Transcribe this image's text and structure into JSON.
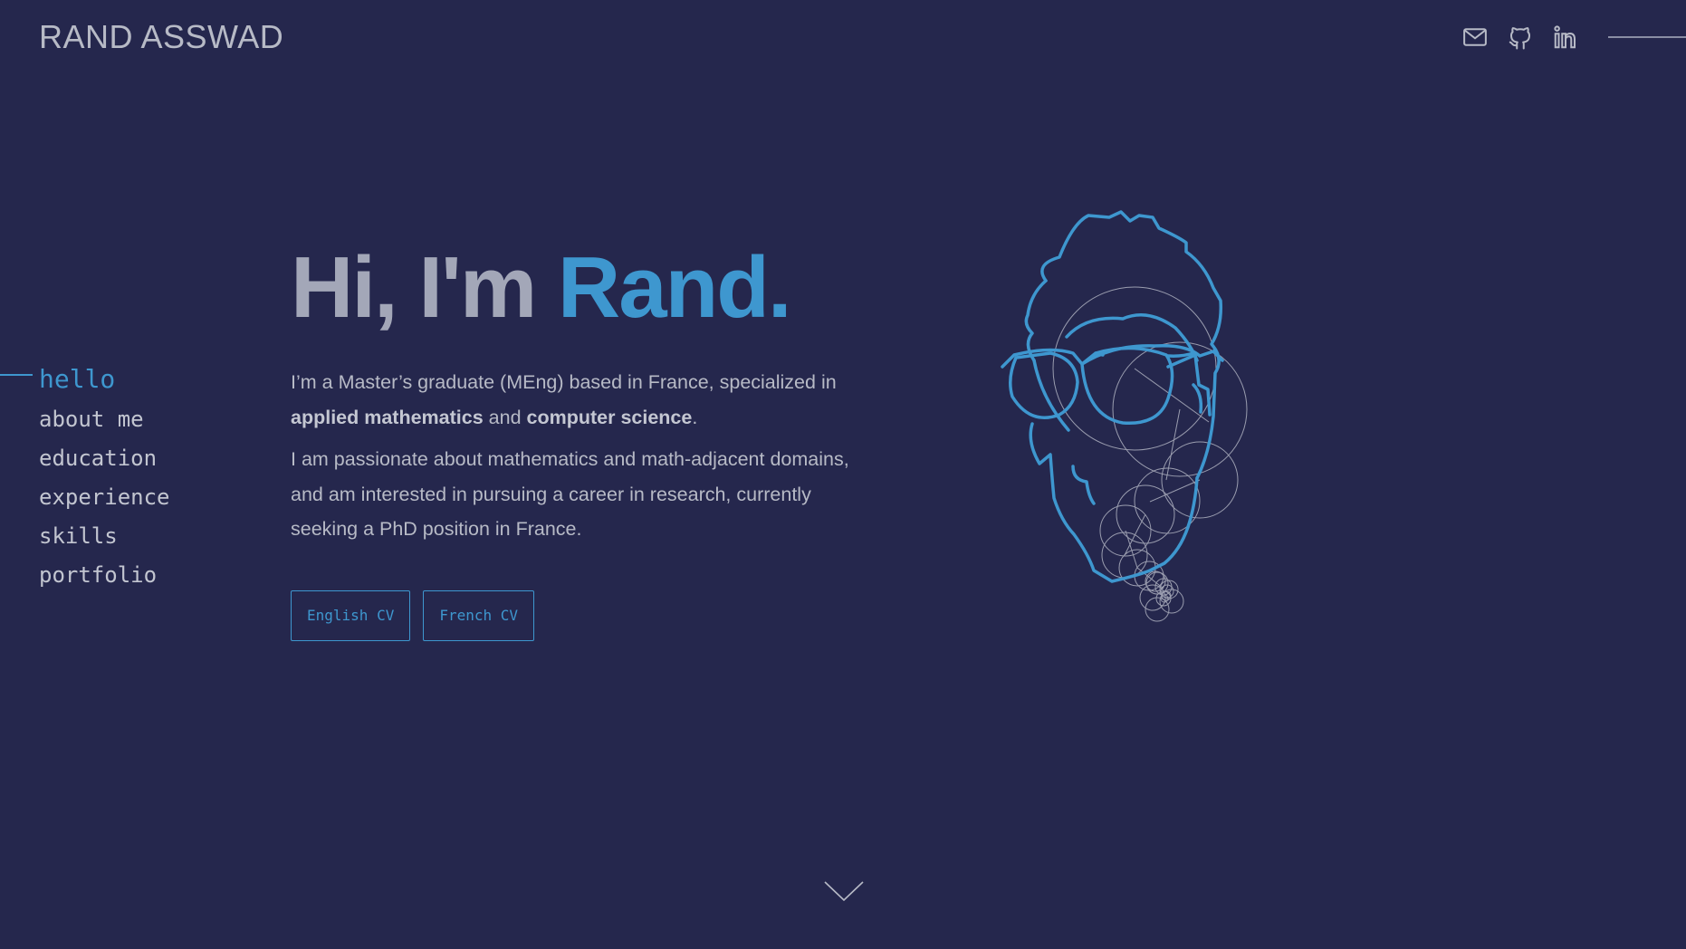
{
  "site_title": "RAND ASSWAD",
  "header_icons": [
    "mail-icon",
    "github-icon",
    "linkedin-icon"
  ],
  "nav": {
    "items": [
      {
        "label": "hello",
        "active": true
      },
      {
        "label": "about me",
        "active": false
      },
      {
        "label": "education",
        "active": false
      },
      {
        "label": "experience",
        "active": false
      },
      {
        "label": "skills",
        "active": false
      },
      {
        "label": "portfolio",
        "active": false
      }
    ]
  },
  "hero": {
    "greeting": "Hi, I'm ",
    "name": "Rand.",
    "para1_pre": "I’m a Master’s graduate (MEng) based in France, specialized in ",
    "para1_bold1": "applied mathematics",
    "para1_mid": " and ",
    "para1_bold2": "computer science",
    "para1_end": ".",
    "para2": "I am passionate about mathematics and math-adjacent domains, and am interested in pursuing a career in research, currently seeking a PhD position in France.",
    "buttons": {
      "english_cv": "English CV",
      "french_cv": "French CV"
    }
  },
  "colors": {
    "background": "#25274d",
    "accent": "#3e97cf",
    "text": "#a3a7b8"
  }
}
